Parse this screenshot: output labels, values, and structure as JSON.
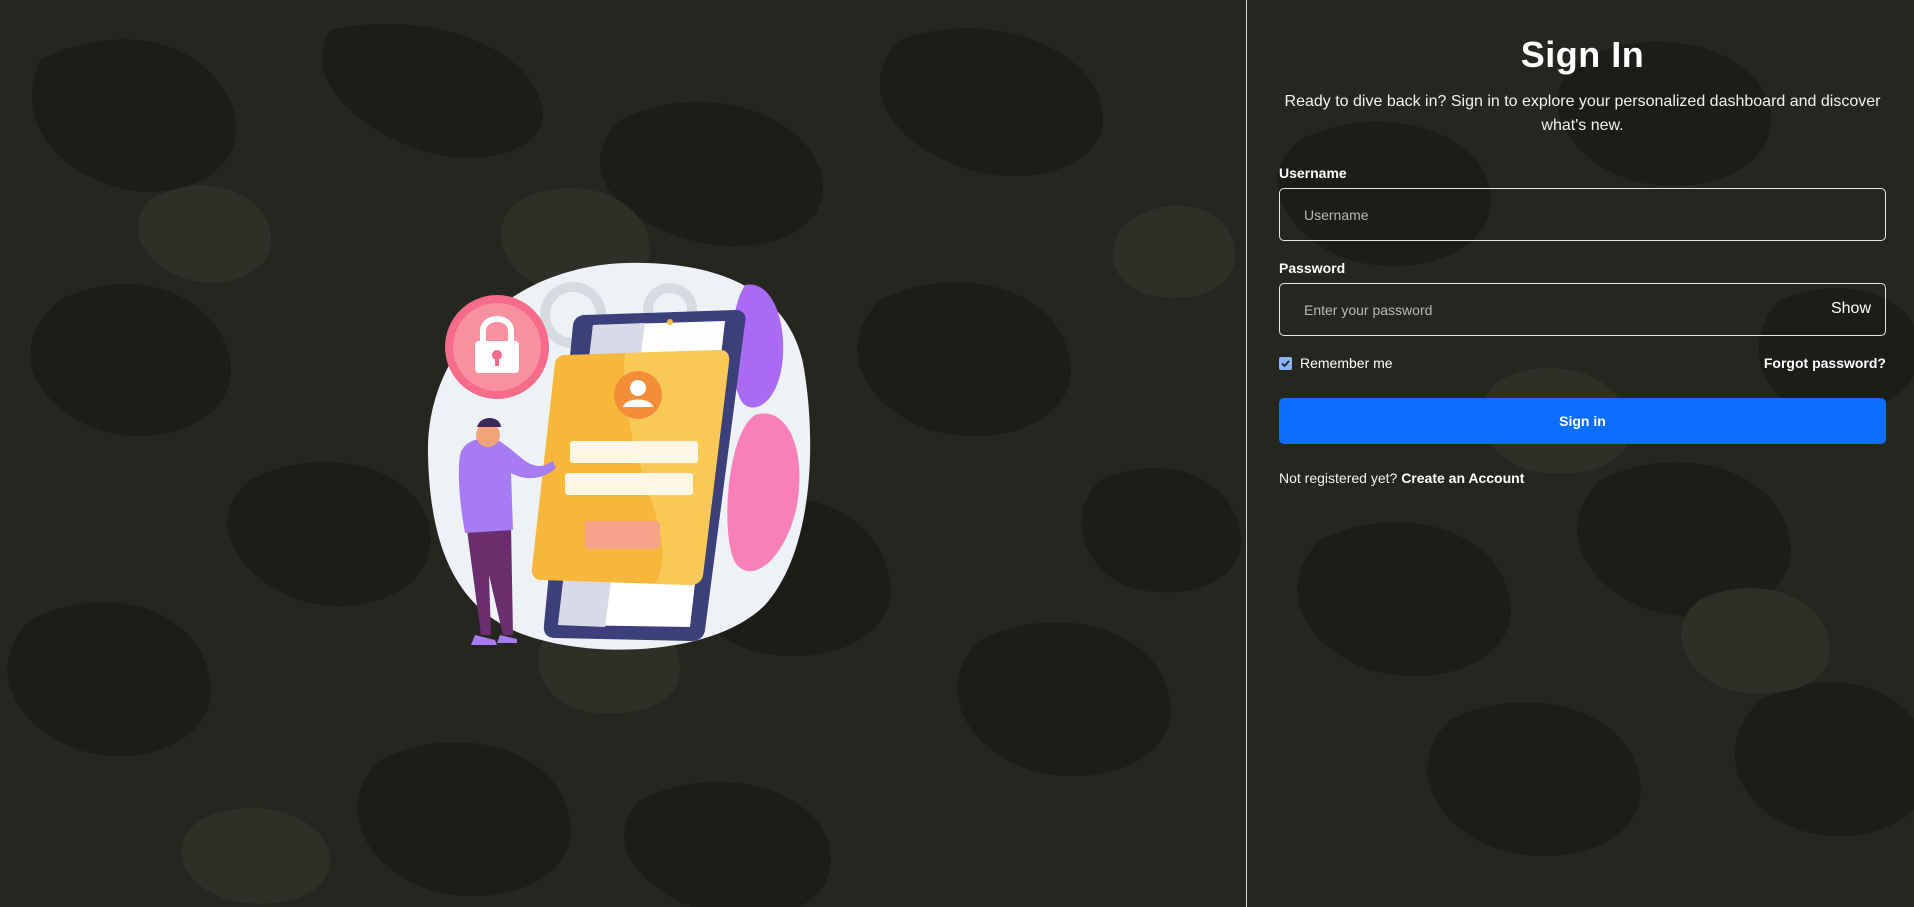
{
  "signin": {
    "title": "Sign In",
    "subtitle": "Ready to dive back in? Sign in to explore your personalized dashboard and discover what's new.",
    "username_label": "Username",
    "username_placeholder": "Username",
    "username_value": "",
    "password_label": "Password",
    "password_placeholder": "Enter your password",
    "password_value": "",
    "show_label": "Show",
    "remember_label": "Remember me",
    "remember_checked": true,
    "forgot_label": "Forgot password?",
    "button_label": "Sign in",
    "register_prompt": "Not registered yet?",
    "register_link": "Create an Account"
  },
  "illustration": {
    "name": "phone-login-illustration"
  },
  "colors": {
    "background": "#262620",
    "camo_dark": "#1c1d18",
    "camo_light": "#2f2f28",
    "primary": "#0d6efd",
    "checkbox": "#8ab4f8",
    "divider": "#d8d8d0"
  },
  "icons": {
    "lock": "lock-icon",
    "user": "user-avatar-icon",
    "gear": "gear-icon",
    "check": "check-icon"
  }
}
